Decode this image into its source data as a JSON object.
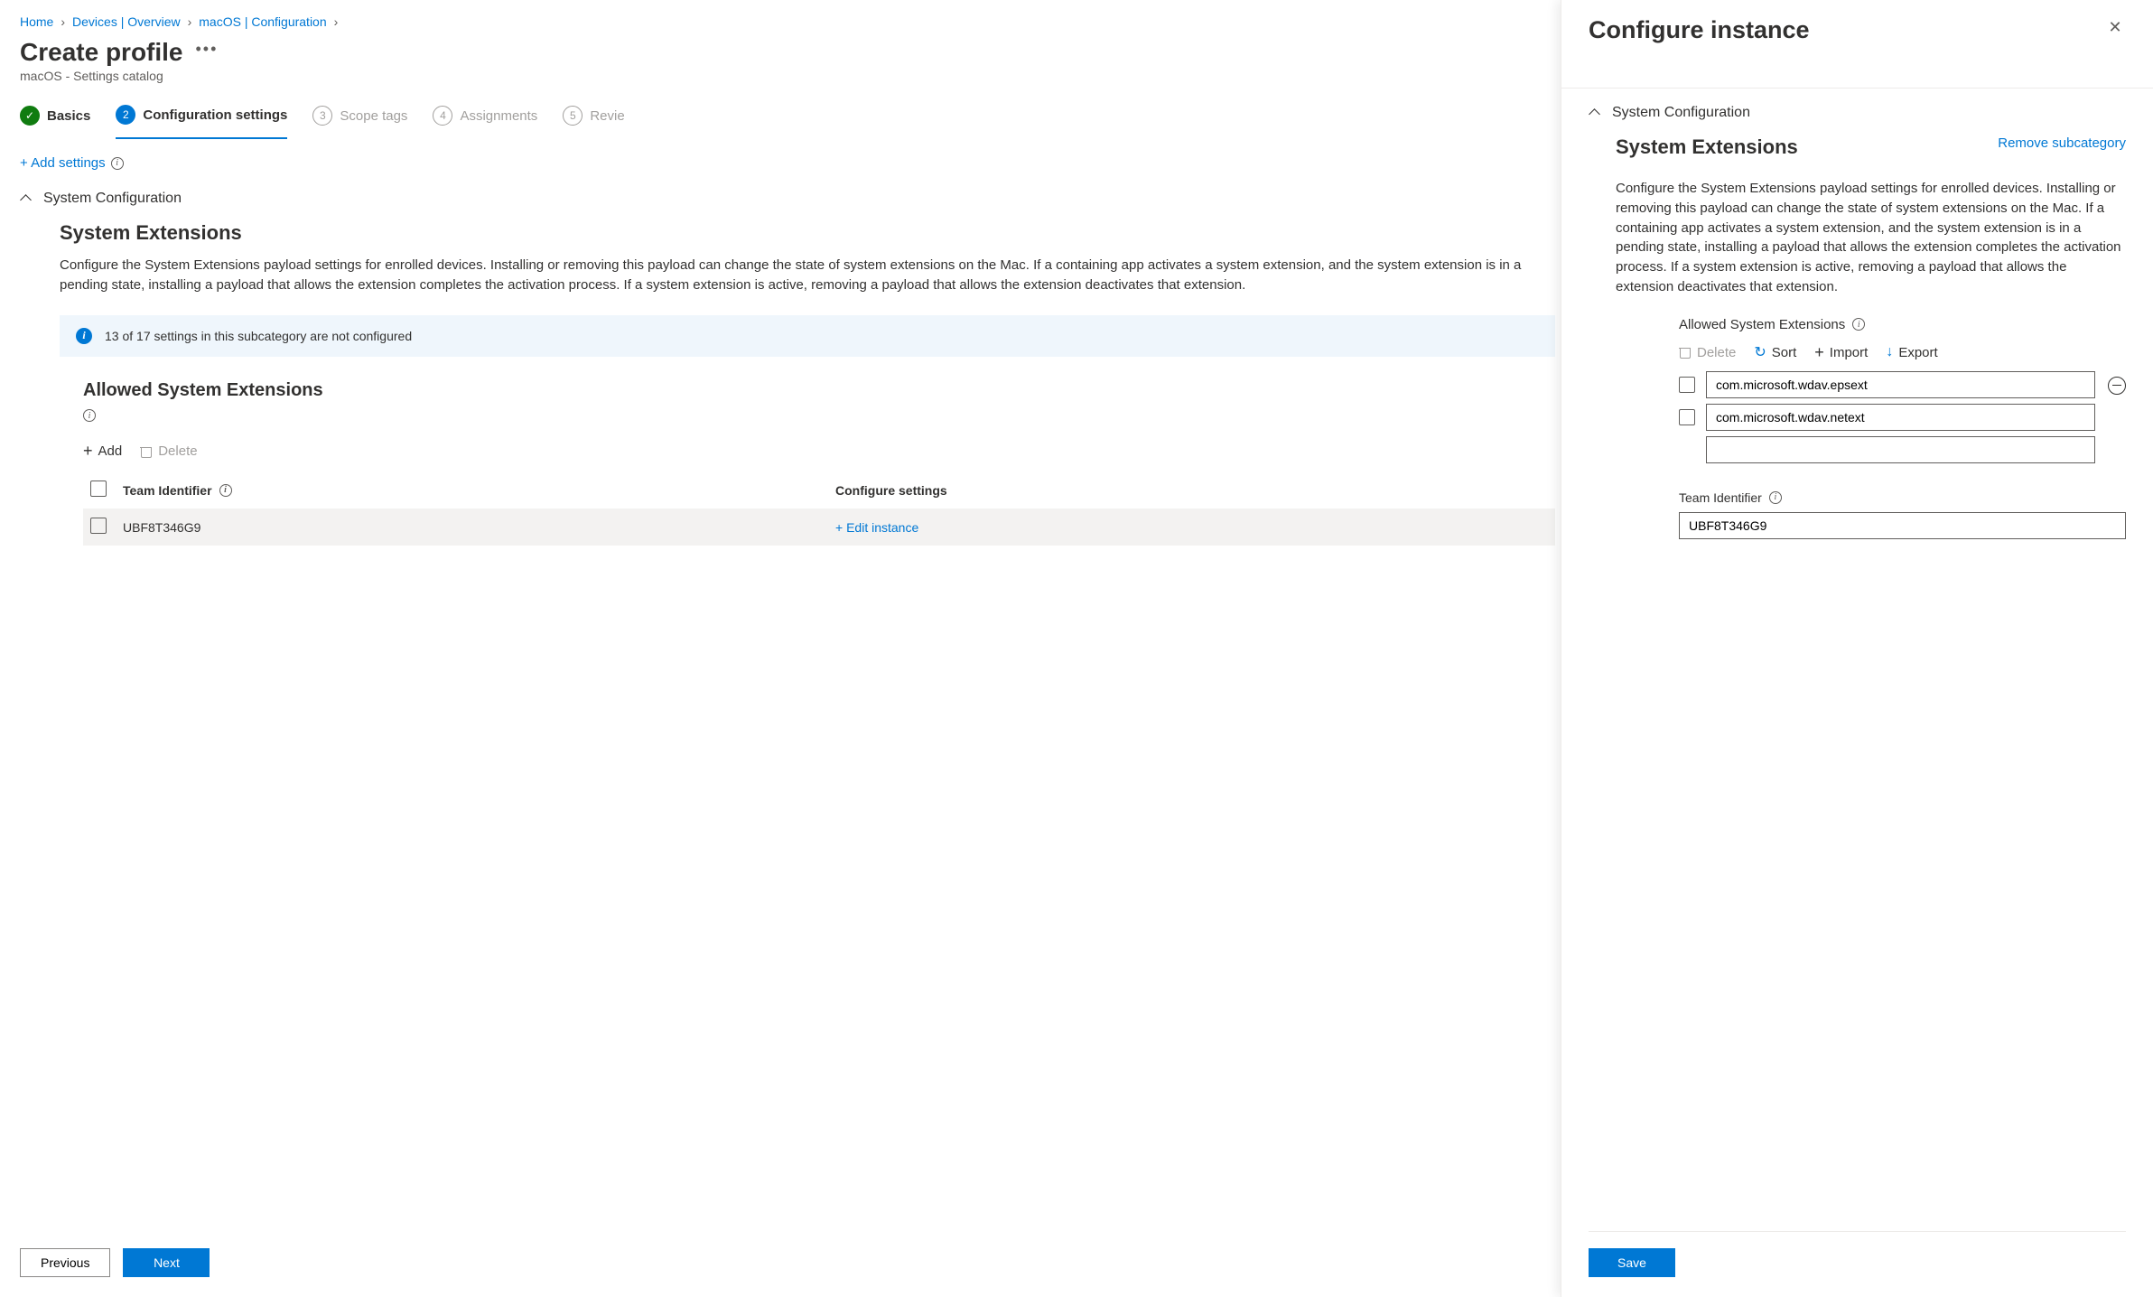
{
  "breadcrumb": [
    {
      "label": "Home"
    },
    {
      "label": "Devices | Overview"
    },
    {
      "label": "macOS | Configuration"
    }
  ],
  "page": {
    "title": "Create profile",
    "subtitle": "macOS - Settings catalog"
  },
  "wizard": {
    "steps": [
      {
        "num": "✓",
        "label": "Basics",
        "state": "done"
      },
      {
        "num": "2",
        "label": "Configuration settings",
        "state": "active"
      },
      {
        "num": "3",
        "label": "Scope tags",
        "state": "pending"
      },
      {
        "num": "4",
        "label": "Assignments",
        "state": "pending"
      },
      {
        "num": "5",
        "label": "Revie",
        "state": "pending"
      }
    ]
  },
  "actions": {
    "add_settings": "+ Add settings"
  },
  "section": {
    "title": "System Configuration",
    "sub_heading": "System Extensions",
    "desc": "Configure the System Extensions payload settings for enrolled devices. Installing or removing this payload can change the state of system extensions on the Mac. If a containing app activates a system extension, and the system extension is in a pending state, installing a payload that allows the extension completes the activation process. If a system extension is active, removing a payload that allows the extension deactivates that extension.",
    "info_bar": "13 of 17 settings in this subcategory are not configured",
    "block_heading": "Allowed System Extensions",
    "toolbar": {
      "add": "Add",
      "delete": "Delete"
    },
    "table": {
      "col_team": "Team Identifier",
      "col_conf": "Configure settings",
      "row_team": "UBF8T346G9",
      "row_edit": "Edit instance"
    }
  },
  "footer": {
    "previous": "Previous",
    "next": "Next"
  },
  "side": {
    "title": "Configure instance",
    "section_title": "System Configuration",
    "sub_heading": "System Extensions",
    "remove_link": "Remove subcategory",
    "desc": "Configure the System Extensions payload settings for enrolled devices. Installing or removing this payload can change the state of system extensions on the Mac. If a containing app activates a system extension, and the system extension is in a pending state, installing a payload that allows the extension completes the activation process. If a system extension is active, removing a payload that allows the extension deactivates that extension.",
    "allowed_label": "Allowed System Extensions",
    "toolbar": {
      "delete": "Delete",
      "sort": "Sort",
      "import": "Import",
      "export": "Export"
    },
    "extensions": [
      "com.microsoft.wdav.epsext",
      "com.microsoft.wdav.netext",
      ""
    ],
    "team_label": "Team Identifier",
    "team_value": "UBF8T346G9",
    "save": "Save"
  }
}
